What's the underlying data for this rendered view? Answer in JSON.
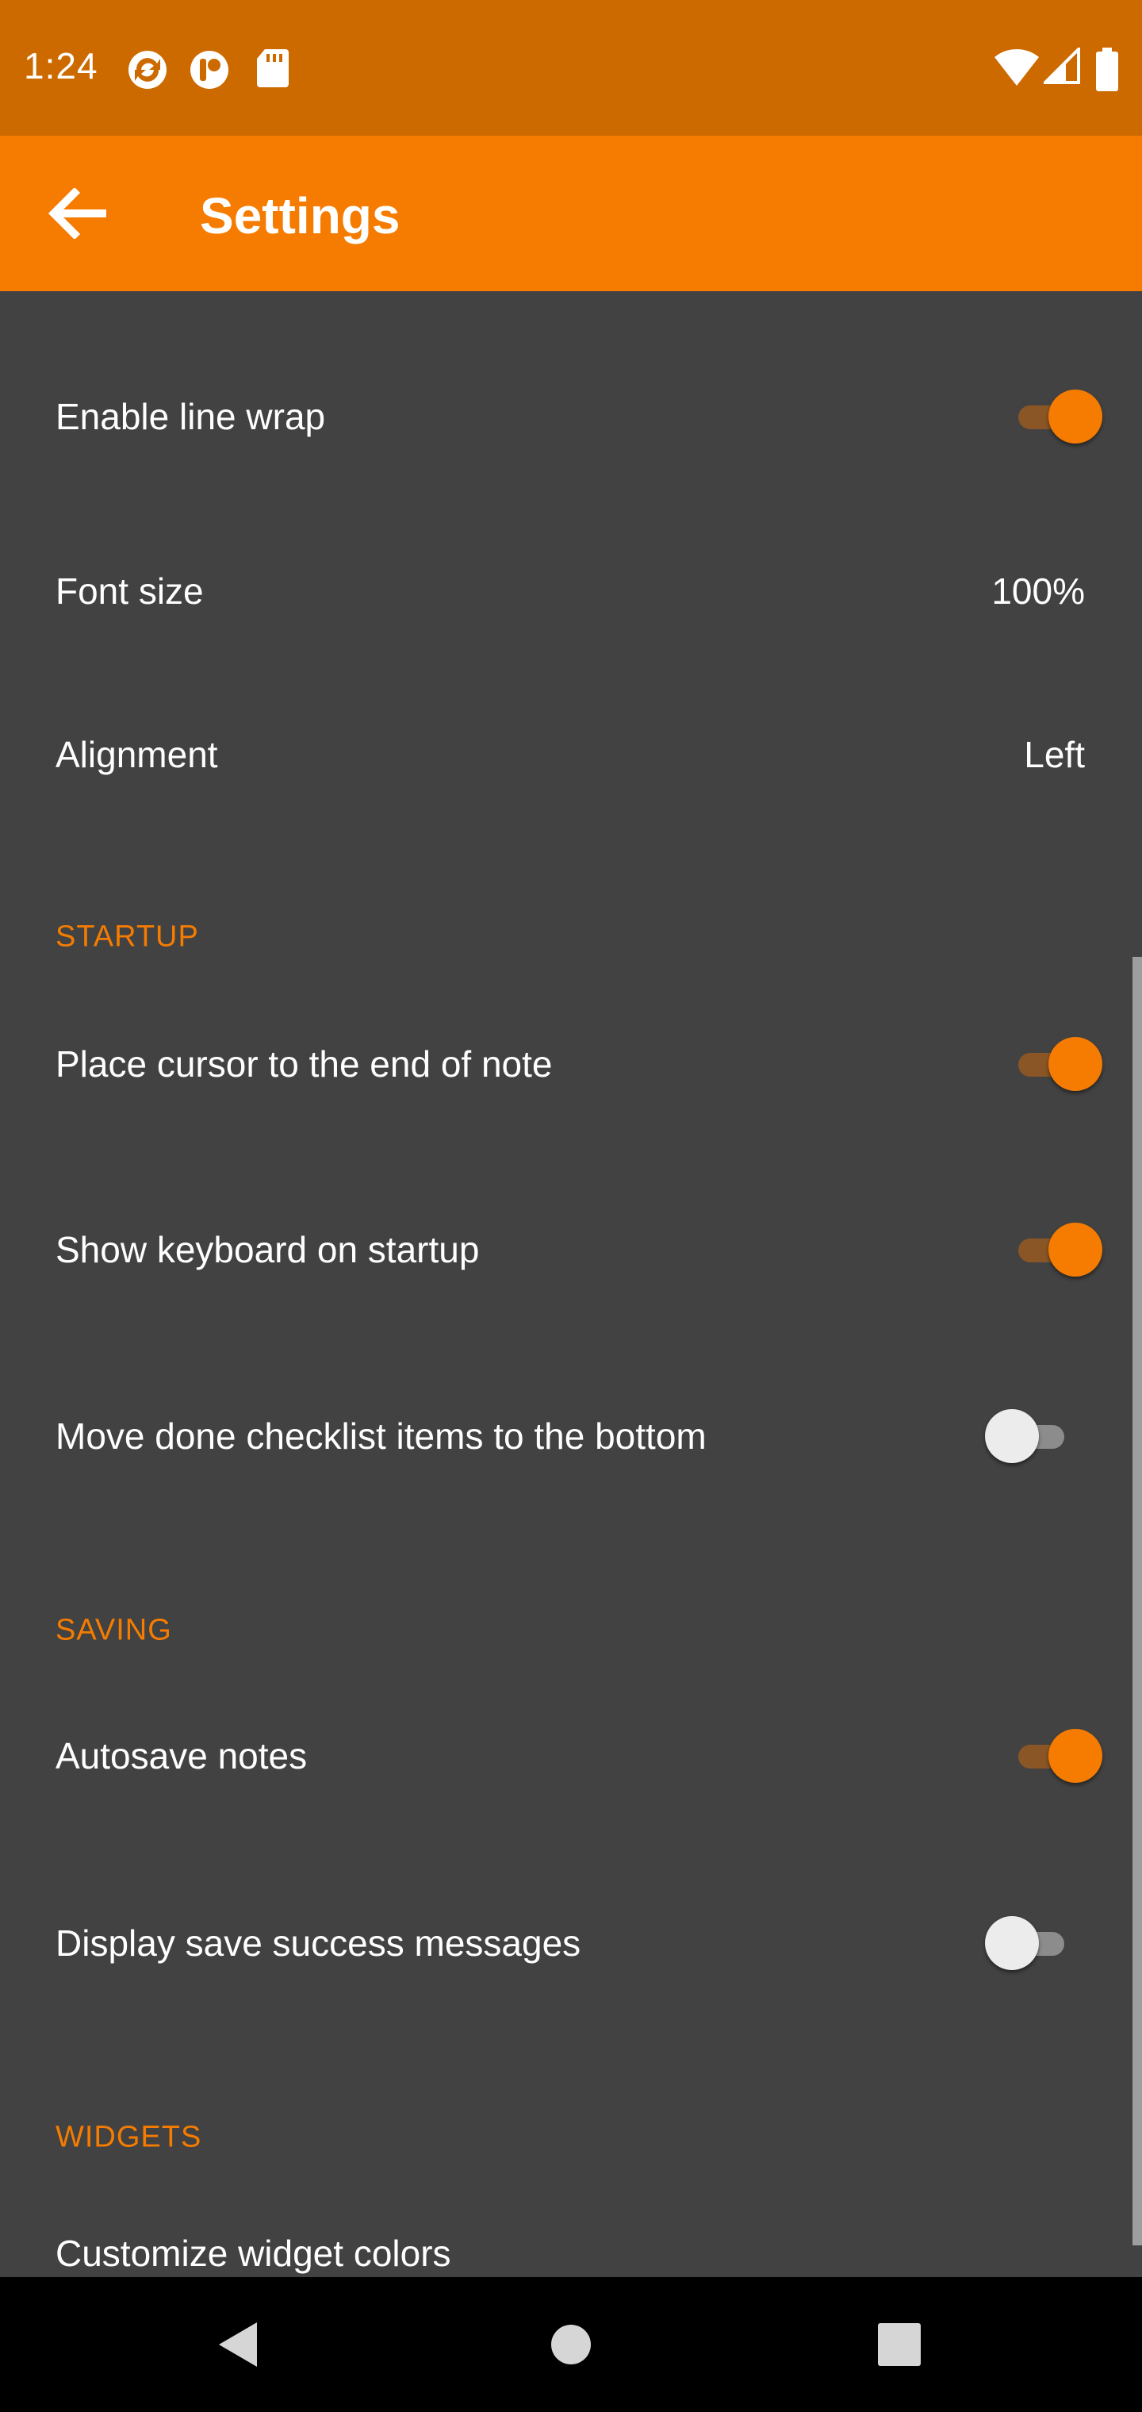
{
  "status_bar": {
    "time": "1:24",
    "left_icons": [
      "sync-app-icon",
      "app-notification-icon",
      "sd-card-icon"
    ],
    "right_icons": [
      "wifi-icon",
      "signal-icon",
      "battery-icon"
    ],
    "color": "#cc6a00"
  },
  "app_bar": {
    "title": "Settings",
    "back_icon": "arrow-back-icon",
    "color": "#f57c00"
  },
  "preferences": {
    "line_wrap": {
      "label": "Enable line wrap",
      "checked": true
    },
    "font_size": {
      "label": "Font size",
      "value": "100%"
    },
    "alignment": {
      "label": "Alignment",
      "value": "Left"
    },
    "startup": {
      "header": "STARTUP",
      "cursor_end": {
        "label": "Place cursor to the end of note",
        "checked": true
      },
      "show_keyboard": {
        "label": "Show keyboard on startup",
        "checked": true
      },
      "move_done": {
        "label": "Move done checklist items to the bottom",
        "checked": false
      }
    },
    "saving": {
      "header": "SAVING",
      "autosave": {
        "label": "Autosave notes",
        "checked": true
      },
      "save_messages": {
        "label": "Display save success messages",
        "checked": false
      }
    },
    "widgets": {
      "header": "WIDGETS",
      "customize_colors": {
        "label": "Customize widget colors"
      }
    }
  },
  "nav_bar": {
    "buttons": [
      "nav-back-icon",
      "nav-home-icon",
      "nav-recents-icon"
    ]
  },
  "colors": {
    "accent": "#f57c00",
    "background": "#424242",
    "text": "#ffffff"
  }
}
